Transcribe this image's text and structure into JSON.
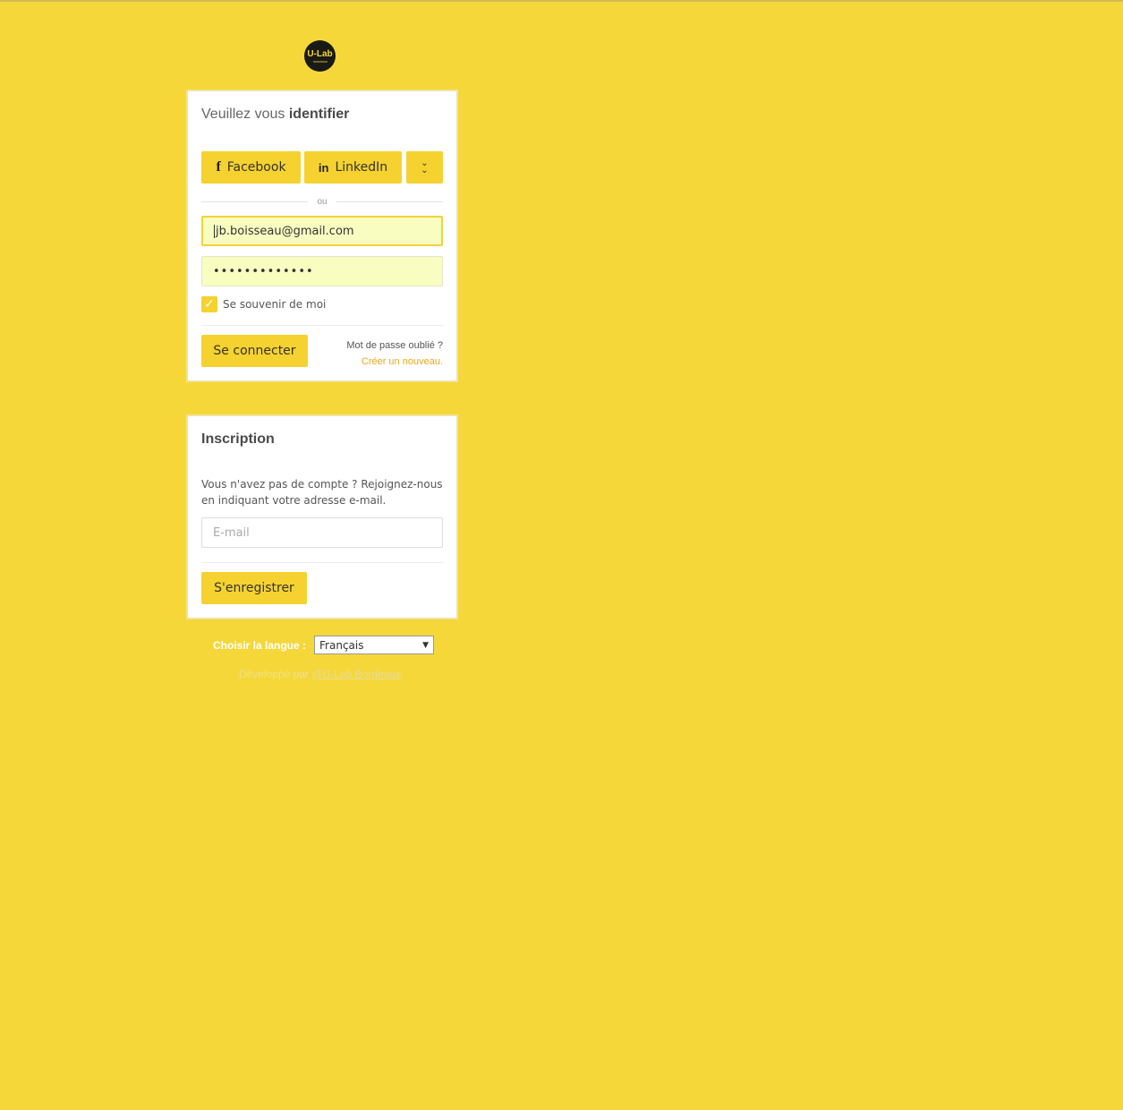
{
  "logo": {
    "text": "U-Lab"
  },
  "login": {
    "title_prefix": "Veuillez vous ",
    "title_bold": "identifier",
    "facebook_label": "Facebook",
    "linkedin_label": "LinkedIn",
    "or_label": "ou",
    "email_value": "jb.boisseau@gmail.com",
    "password_value": "•••••••••••••",
    "remember_label": "Se souvenir de moi",
    "remember_checked": true,
    "submit_label": "Se connecter",
    "forgot_question": "Mot de passe oublié ?",
    "forgot_link": "Créer un nouveau."
  },
  "signup": {
    "title": "Inscription",
    "text": "Vous n'avez pas de compte ? Rejoignez-nous en indiquant votre adresse e-mail.",
    "email_placeholder": "E-mail",
    "submit_label": "S'enregistrer"
  },
  "language": {
    "label": "Choisir la langue :",
    "selected": "Français"
  },
  "footer": {
    "prefix": "Développé par ",
    "link": "@U-Lab Bordeaux"
  },
  "colors": {
    "background": "#f5d73a",
    "button": "#f5d22f",
    "link": "#e8a81b",
    "autofill": "#f9fdc0"
  }
}
